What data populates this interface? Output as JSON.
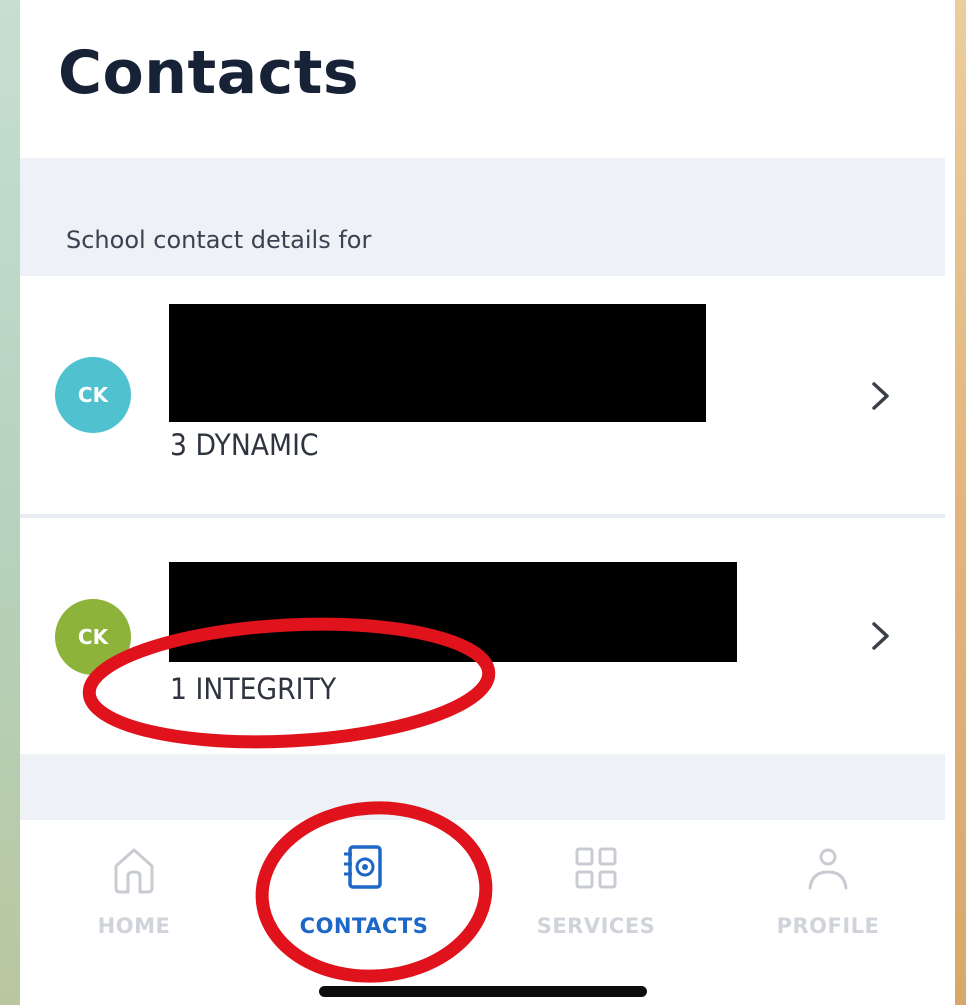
{
  "header": {
    "title": "Contacts"
  },
  "section": {
    "label": "School contact details for"
  },
  "contacts": [
    {
      "initials": "CK",
      "subtitle": "3 DYNAMIC",
      "avatar_color": "#4fc1cf"
    },
    {
      "initials": "CK",
      "subtitle": "1 INTEGRITY",
      "avatar_color": "#8db33a"
    }
  ],
  "tabbar": {
    "tabs": [
      {
        "label": "HOME",
        "icon": "home-icon",
        "active": false
      },
      {
        "label": "CONTACTS",
        "icon": "contacts-book-icon",
        "active": true
      },
      {
        "label": "SERVICES",
        "icon": "grid-icon",
        "active": false
      },
      {
        "label": "PROFILE",
        "icon": "person-icon",
        "active": false
      }
    ]
  },
  "colors": {
    "accent": "#1d67c7",
    "title": "#172236",
    "annotation_red": "#e0121b",
    "inactive_tab": "#d0d4da"
  }
}
